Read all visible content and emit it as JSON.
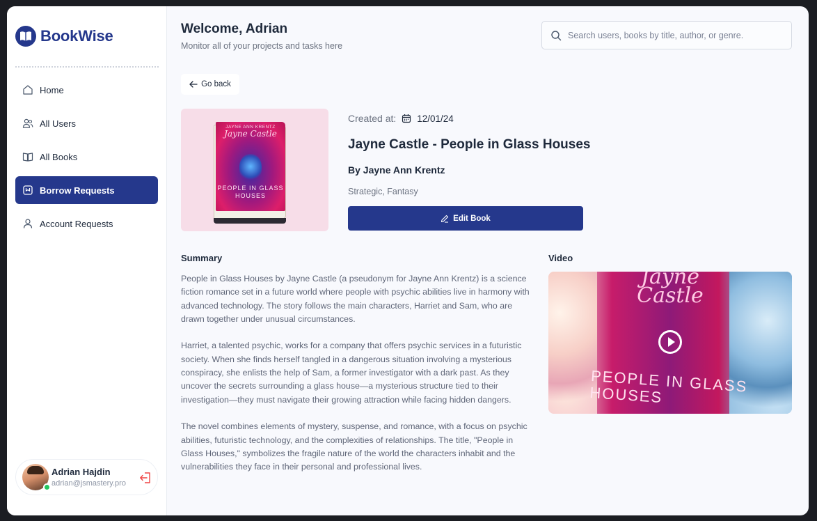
{
  "app": {
    "name": "BookWise"
  },
  "colors": {
    "primary": "#25388c",
    "cover_bg": "#f7dde8",
    "online": "#22c55e",
    "logout": "#ef4444"
  },
  "sidebar": {
    "items": [
      {
        "label": "Home",
        "icon": "home-icon",
        "active": false
      },
      {
        "label": "All Users",
        "icon": "users-icon",
        "active": false
      },
      {
        "label": "All Books",
        "icon": "book-open-icon",
        "active": false
      },
      {
        "label": "Borrow Requests",
        "icon": "bookmark-icon",
        "active": true
      },
      {
        "label": "Account Requests",
        "icon": "user-icon",
        "active": false
      }
    ],
    "user": {
      "name": "Adrian Hajdin",
      "email": "adrian@jsmastery.pro"
    }
  },
  "header": {
    "title": "Welcome, Adrian",
    "subtitle": "Monitor all of your projects and tasks here",
    "search_placeholder": "Search users, books by title, author, or genre."
  },
  "back_label": "Go back",
  "book": {
    "created_label": "Created at:",
    "created_date": "12/01/24",
    "title": "Jayne Castle - People in Glass Houses",
    "author": "By Jayne Ann Krentz",
    "genre": "Strategic, Fantasy",
    "edit_label": "Edit Book",
    "cover": {
      "author_text": "JAYNE ANN KRENTZ",
      "brand_text": "Jayne Castle",
      "title_text": "PEOPLE IN GLASS HOUSES"
    }
  },
  "summary": {
    "heading": "Summary",
    "paragraphs": [
      "People in Glass Houses by Jayne Castle (a pseudonym for Jayne Ann Krentz) is a science fiction romance set in a future world where people with psychic abilities live in harmony with advanced technology. The story follows the main characters, Harriet and Sam, who are drawn together under unusual circumstances.",
      "Harriet, a talented psychic, works for a company that offers psychic services in a futuristic society. When she finds herself tangled in a dangerous situation involving a mysterious conspiracy, she enlists the help of Sam, a former investigator with a dark past. As they uncover the secrets surrounding a glass house—a mysterious structure tied to their investigation—they must navigate their growing attraction while facing hidden dangers.",
      "The novel combines elements of mystery, suspense, and romance, with a focus on psychic abilities, futuristic technology, and the complexities of relationships. The title, \"People in Glass Houses,\" symbolizes the fragile nature of the world the characters inhabit and the vulnerabilities they face in their personal and professional lives."
    ]
  },
  "video": {
    "heading": "Video",
    "author_text": "Jayne Castle",
    "title_text": "PEOPLE IN GLASS HOUSES"
  }
}
